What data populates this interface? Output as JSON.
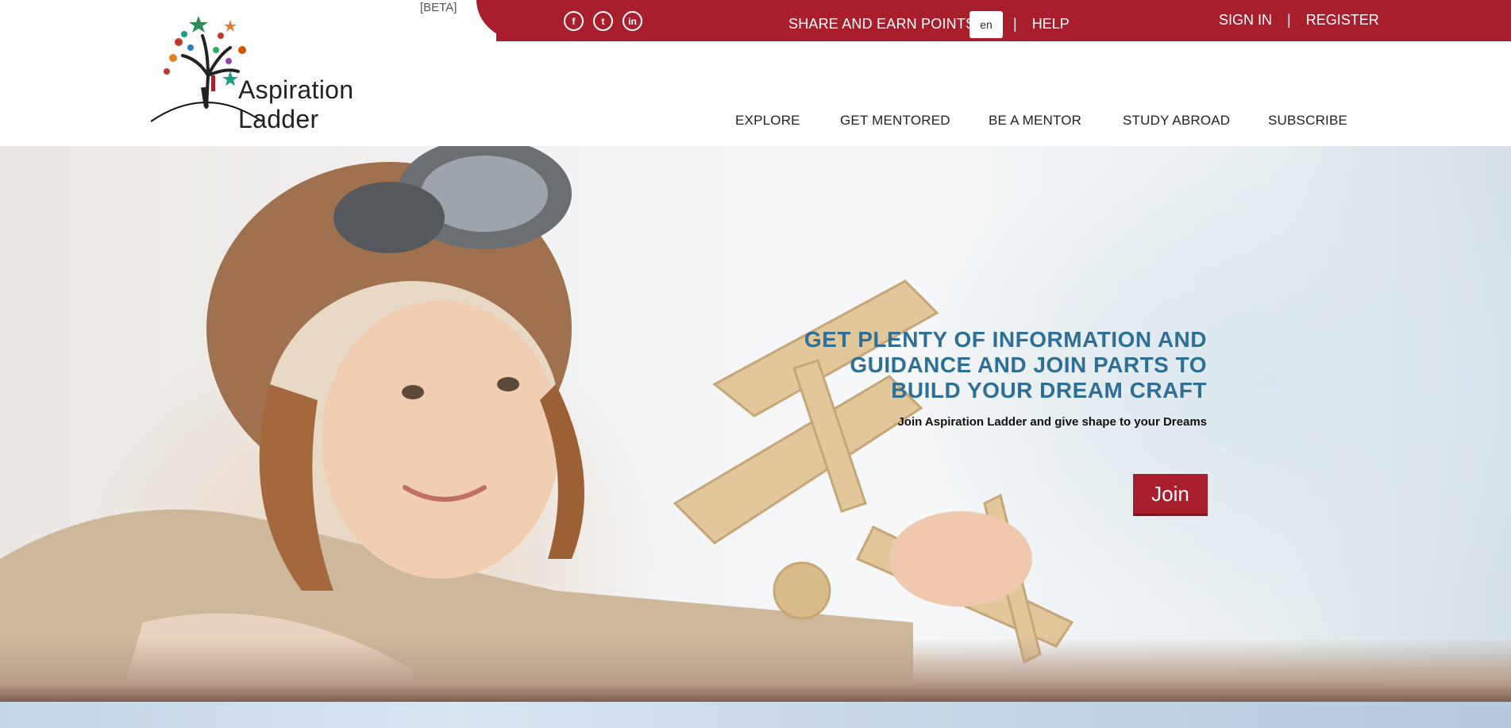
{
  "header": {
    "beta_tag": "[BETA]",
    "brand": "Aspiration Ladder",
    "social_icons": [
      {
        "icon": "facebook-icon",
        "glyph": "f"
      },
      {
        "icon": "twitter-icon",
        "glyph": "t"
      },
      {
        "icon": "linkedin-icon",
        "glyph": "in"
      }
    ],
    "share_label": "SHARE AND EARN POINTS",
    "language_value": "en",
    "separator": "|",
    "help_label": "HELP",
    "sign_in_label": "SIGN IN",
    "register_label": "REGISTER",
    "accent_color": "#a81e2d"
  },
  "nav": {
    "items": [
      {
        "label": "EXPLORE"
      },
      {
        "label": "GET MENTORED"
      },
      {
        "label": "BE A MENTOR"
      },
      {
        "label": "STUDY ABROAD"
      },
      {
        "label": "SUBSCRIBE"
      }
    ]
  },
  "hero": {
    "headline_line1": "GET PLENTY OF INFORMATION AND",
    "headline_line2": "GUIDANCE AND JOIN PARTS TO",
    "headline_line3": "BUILD YOUR DREAM CRAFT",
    "subheadline": "Join Aspiration Ladder and give shape to your Dreams",
    "join_label": "Join",
    "headline_color": "#2f6f96"
  }
}
